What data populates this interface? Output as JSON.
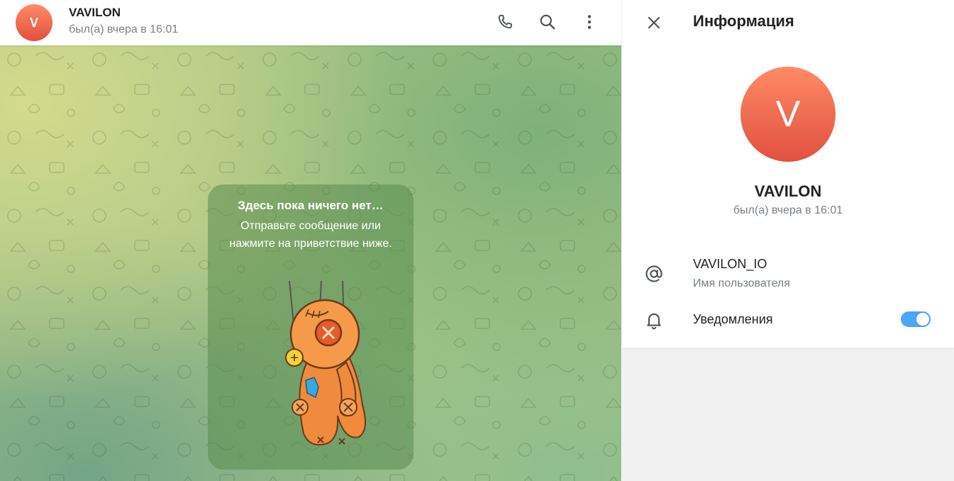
{
  "chat": {
    "avatar_letter": "V",
    "title": "VAVILON",
    "status": "был(а) вчера в 16:01",
    "actions": [
      {
        "name": "phone-icon"
      },
      {
        "name": "search-icon"
      },
      {
        "name": "more-vertical-icon"
      }
    ],
    "empty_state": {
      "title": "Здесь пока ничего нет…",
      "text": "Отправьте сообщение или нажмите на приветствие ниже."
    }
  },
  "info": {
    "close_icon": "close-icon",
    "title": "Информация",
    "avatar_letter": "V",
    "name": "VAVILON",
    "status": "был(а) вчера в 16:01",
    "username": {
      "icon": "at-sign-icon",
      "value": "VAVILON_IO",
      "label": "Имя пользователя"
    },
    "notifications": {
      "icon": "bell-icon",
      "label": "Уведомления",
      "enabled": true
    }
  },
  "colors": {
    "avatar_top": "#ff8a65",
    "avatar_bottom": "#e0513f",
    "toggle_on": "#4ea4f6"
  }
}
